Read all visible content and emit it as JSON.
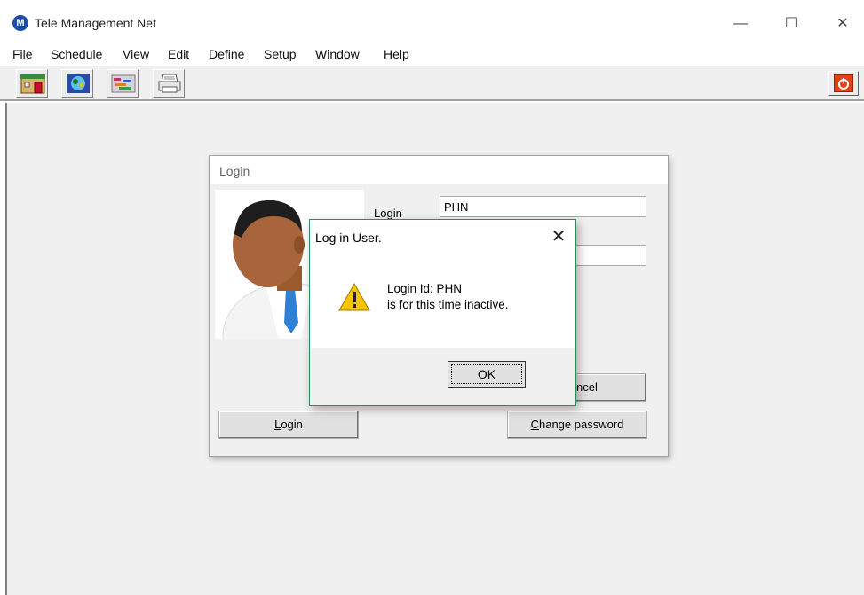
{
  "window": {
    "app_logo_glyph": "M",
    "title": "Tele Management Net",
    "minimize_glyph": "—",
    "maximize_glyph": "☐",
    "close_glyph": "✕"
  },
  "menu": {
    "items": [
      "File",
      "Schedule",
      "View",
      "Edit",
      "Define",
      "Setup",
      "Window",
      "Help"
    ]
  },
  "toolbar": {
    "buttons": [
      "building-icon",
      "network-icon",
      "schedule-icon",
      "printer-icon"
    ],
    "power_icon": "power-icon",
    "power_color": "#e0401a"
  },
  "login_dialog": {
    "title": "Login",
    "login_label": "Login",
    "login_value": "PHN",
    "password_value": "",
    "login_button": "Login",
    "login_button_mnemonic": "L",
    "cancel_button_visible": "ncel",
    "change_password_button": "Change password",
    "change_password_mnemonic": "C"
  },
  "message_box": {
    "title": "Log in User.",
    "close_glyph": "✕",
    "icon": "warning-icon",
    "line1": "Login Id: PHN",
    "line2": "is for this time inactive.",
    "ok_button": "OK",
    "border_color": "#2e8b57"
  }
}
